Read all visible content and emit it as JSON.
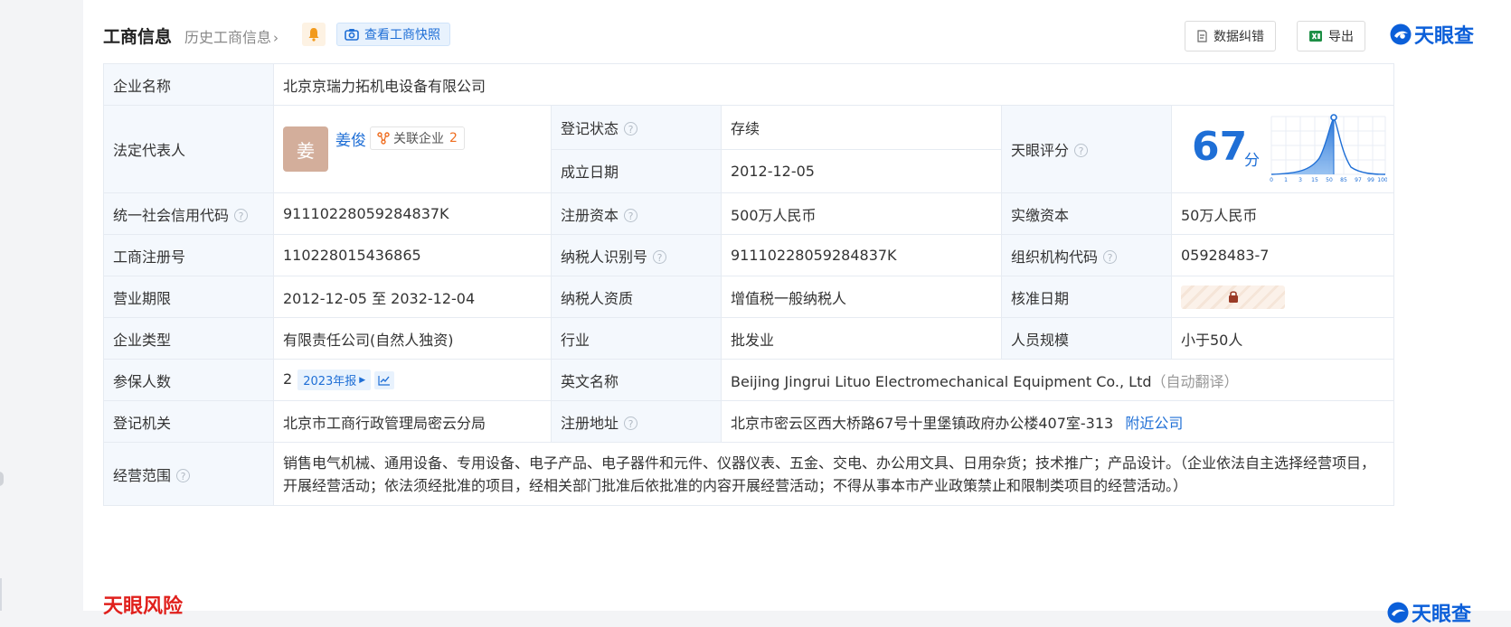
{
  "header": {
    "title": "工商信息",
    "history": "历史工商信息",
    "snapshot": "查看工商快照",
    "fix": "数据纠错",
    "export": "导出",
    "brand": "天眼查"
  },
  "company": {
    "name_label": "企业名称",
    "name": "北京京瑞力拓机电设备有限公司",
    "legal_label": "法定代表人",
    "legal_avatar": "姜",
    "legal_name": "姜俊",
    "related_label": "关联企业",
    "related_count": "2",
    "status_label": "登记状态",
    "status": "存续",
    "founded_label": "成立日期",
    "founded": "2012-12-05",
    "score_label": "天眼评分",
    "score": "67",
    "score_unit": "分",
    "score_ticks": [
      "0",
      "1",
      "3",
      "15",
      "50",
      "85",
      "97",
      "99",
      "100"
    ],
    "credit_label": "统一社会信用代码",
    "credit": "91110228059284837K",
    "reg_capital_label": "注册资本",
    "reg_capital": "500万人民币",
    "paid_capital_label": "实缴资本",
    "paid_capital": "50万人民币",
    "reg_no_label": "工商注册号",
    "reg_no": "110228015436865",
    "taxpayer_id_label": "纳税人识别号",
    "taxpayer_id": "91110228059284837K",
    "org_code_label": "组织机构代码",
    "org_code": "05928483-7",
    "term_label": "营业期限",
    "term": "2012-12-05 至 2032-12-04",
    "taxpayer_qual_label": "纳税人资质",
    "taxpayer_qual": "增值税一般纳税人",
    "approve_label": "核准日期",
    "type_label": "企业类型",
    "type": "有限责任公司(自然人独资)",
    "industry_label": "行业",
    "industry": "批发业",
    "staff_label": "人员规模",
    "staff": "小于50人",
    "insured_label": "参保人数",
    "insured": "2",
    "insured_year": "2023年报",
    "en_name_label": "英文名称",
    "en_name": "Beijing Jingrui Lituo Electromechanical Equipment Co., Ltd",
    "en_auto": "（自动翻译）",
    "authority_label": "登记机关",
    "authority": "北京市工商行政管理局密云分局",
    "address_label": "注册地址",
    "address": "北京市密云区西大桥路67号十里堡镇政府办公楼407室-313",
    "nearby": "附近公司",
    "scope_label": "经营范围",
    "scope": "销售电气机械、通用设备、专用设备、电子产品、电子器件和元件、仪器仪表、五金、交电、办公用文具、日用杂货；技术推广；产品设计。（企业依法自主选择经营项目，开展经营活动；依法须经批准的项目，经相关部门批准后依批准的内容开展经营活动；不得从事本市产业政策禁止和限制类项目的经营活动。）"
  },
  "bottom": {
    "risk_title": "天眼风险",
    "brand": "天眼查"
  },
  "colors": {
    "accent": "#1f6fd6",
    "status_green": "#1aa34a",
    "risk_red": "#e0201c",
    "label_bg": "#f4f8fd"
  }
}
